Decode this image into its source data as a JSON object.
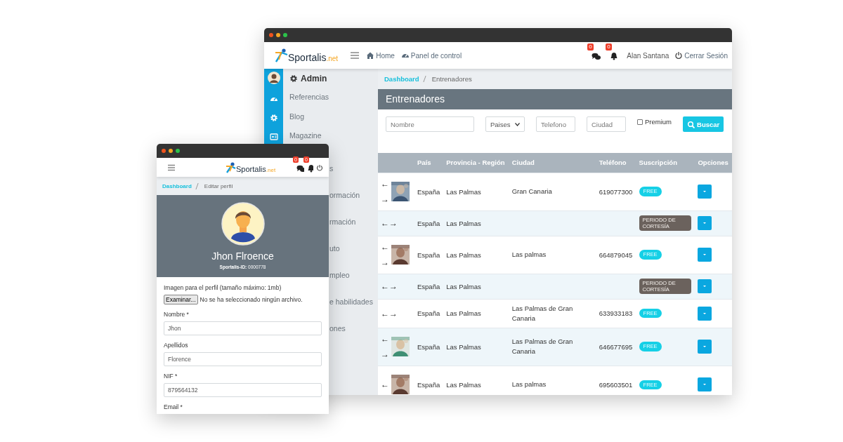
{
  "main_window": {
    "navbar": {
      "logo": {
        "name": "Sportalis",
        "suffix": ".net"
      },
      "links": [
        "Home",
        "Panel de control"
      ],
      "badges": [
        "0",
        "0"
      ],
      "user": "Alan Santana",
      "logout": "Cerrar Sesión"
    },
    "sidebar": {
      "title": "Admin",
      "items": [
        "Referencias",
        "Blog",
        "Magazine"
      ],
      "covered_items": [
        "s",
        "ormación",
        "rmación",
        "uto",
        "mpleo",
        "e habilidades",
        "ones"
      ]
    },
    "breadcrumb": [
      {
        "label": "Dashboard",
        "link": true
      },
      {
        "label": "Entrenadores",
        "link": false
      }
    ],
    "page_title": "Entrenadores",
    "filters": {
      "name_field": {
        "placeholder": "Nombre"
      },
      "country_select": "Paises",
      "phone_field": {
        "placeholder": "Telefono"
      },
      "city_field": {
        "placeholder": "Ciudad"
      },
      "premium": {
        "label": "Premium",
        "checked": false
      },
      "search_button": "Buscar"
    },
    "table": {
      "columns": [
        "País",
        "Provincia - Región",
        "Ciudad",
        "Teléfono",
        "Suscripción",
        "Opciones"
      ],
      "rows": [
        {
          "photo": true,
          "arrows": [
            "←",
            "→"
          ],
          "country": "España",
          "province": "Las Palmas",
          "city": "Gran Canaria",
          "phone": "619077300",
          "subscription": {
            "kind": "free",
            "label": "FREE"
          }
        },
        {
          "photo": false,
          "arrows": [
            "←",
            "→"
          ],
          "country": "España",
          "province": "Las Palmas",
          "subscription": {
            "kind": "courtesy",
            "label": "PERIODO DE CORTESÍA"
          }
        },
        {
          "photo": true,
          "arrows": [
            "←",
            "→"
          ],
          "country": "España",
          "province": "Las Palmas",
          "city": "Las palmas",
          "phone": "664879045",
          "subscription": {
            "kind": "free",
            "label": "FREE"
          }
        },
        {
          "photo": false,
          "arrows": [
            "←",
            "→"
          ],
          "country": "España",
          "province": "Las Palmas",
          "subscription": {
            "kind": "courtesy",
            "label": "PERIODO DE CORTESÍA"
          }
        },
        {
          "photo": false,
          "arrows": [
            "←",
            "→"
          ],
          "country": "España",
          "province": "Las Palmas",
          "city": "Las Palmas de Gran Canaria",
          "phone": "633933183",
          "subscription": {
            "kind": "free",
            "label": "FREE"
          }
        },
        {
          "photo": true,
          "arrows": [
            "←",
            "→"
          ],
          "country": "España",
          "province": "Las Palmas",
          "city": "Las Palmas de Gran Canaria",
          "phone": "646677695",
          "subscription": {
            "kind": "free",
            "label": "FREE"
          }
        },
        {
          "photo": true,
          "arrows": [
            "←"
          ],
          "country": "España",
          "province": "Las Palmas",
          "city": "Las palmas",
          "phone": "695603501",
          "subscription": {
            "kind": "free",
            "label": "FREE"
          }
        }
      ]
    }
  },
  "profile_window": {
    "navbar": {
      "logo": {
        "name": "Sportalis",
        "suffix": ".net"
      },
      "badges": [
        "0",
        "0"
      ]
    },
    "breadcrumb": [
      {
        "label": "Dashboard",
        "link": true
      },
      {
        "label": "Editar perfil",
        "link": false
      }
    ],
    "profile": {
      "name": "Jhon Flroence",
      "id_line": "**Sportalis-ID:** 0000778"
    },
    "form": {
      "image_label": "Imagen para el perfil (tamaño máximo: 1mb)",
      "file_button": "Examinar...",
      "file_status": "No se ha seleccionado ningún archivo.",
      "fields": [
        {
          "label": "Nombre *",
          "value": "Jhon"
        },
        {
          "label": "Apellidos",
          "value": "Florence"
        },
        {
          "label": "NIF *",
          "value": "879564132"
        },
        {
          "label": "Email *"
        }
      ]
    }
  }
}
